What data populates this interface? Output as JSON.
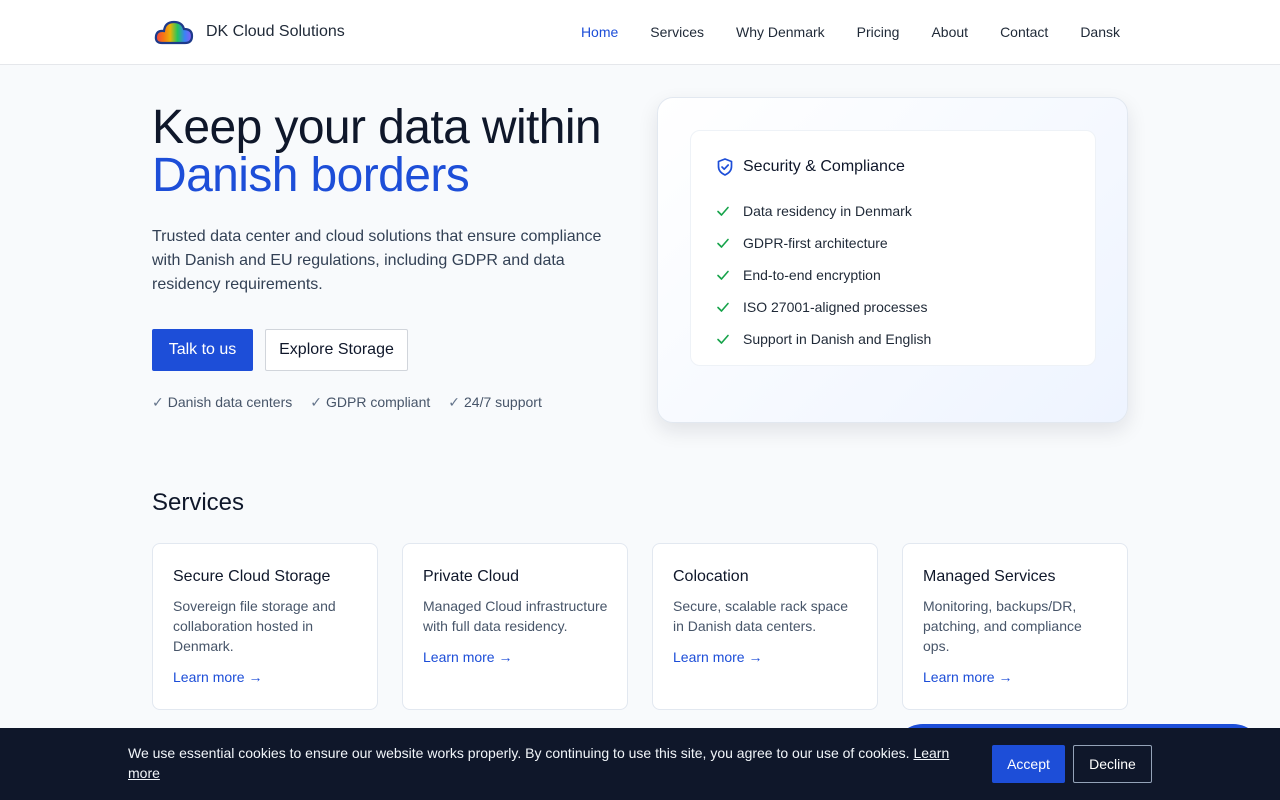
{
  "brand": {
    "name": "DK Cloud Solutions",
    "logo_icon": "rainbow-cloud-icon"
  },
  "nav": {
    "items": [
      {
        "label": "Home",
        "active": true
      },
      {
        "label": "Services",
        "active": false
      },
      {
        "label": "Why Denmark",
        "active": false
      },
      {
        "label": "Pricing",
        "active": false
      },
      {
        "label": "About",
        "active": false
      },
      {
        "label": "Contact",
        "active": false
      },
      {
        "label": "Dansk",
        "active": false
      }
    ]
  },
  "hero": {
    "title_line1": "Keep your data within",
    "title_line2": "Danish borders",
    "subtitle": "Trusted data center and cloud solutions that ensure compliance with Danish and EU regulations, including GDPR and data residency requirements.",
    "primary_button": "Talk to us",
    "secondary_button": "Explore Storage",
    "badges": [
      {
        "check": "✓",
        "label": "Danish data centers"
      },
      {
        "check": "✓",
        "label": "GDPR compliant"
      },
      {
        "check": "✓",
        "label": "24/7 support"
      }
    ]
  },
  "security": {
    "title": "Security & Compliance",
    "icon": "shield-check-icon",
    "items": [
      "Data residency in Denmark",
      "GDPR-first architecture",
      "End-to-end encryption",
      "ISO 27001-aligned processes",
      "Support in Danish and English"
    ]
  },
  "services": {
    "heading": "Services",
    "cards": [
      {
        "title": "Secure Cloud Storage",
        "description": "Sovereign file storage and collaboration hosted in Denmark.",
        "link": "Learn more →"
      },
      {
        "title": "Private Cloud",
        "description": "Managed Cloud infrastructure with full data residency.",
        "link": "Learn more →"
      },
      {
        "title": "Colocation",
        "description": "Secure, scalable rack space in Danish data centers.",
        "link": "Learn more →"
      },
      {
        "title": "Managed Services",
        "description": "Monitoring, backups/DR, patching, and compliance ops.",
        "link": "Learn more →"
      }
    ]
  },
  "cookie": {
    "text": "We use essential cookies to ensure our website works properly. By continuing to use this site, you agree to our use of cookies.",
    "link": "Learn more",
    "accept": "Accept",
    "decline": "Decline"
  },
  "colors": {
    "accent": "#1d4ed8",
    "check_green": "#16a34a",
    "cookie_bg": "#0f172a",
    "page_bg": "#f8fafc"
  }
}
